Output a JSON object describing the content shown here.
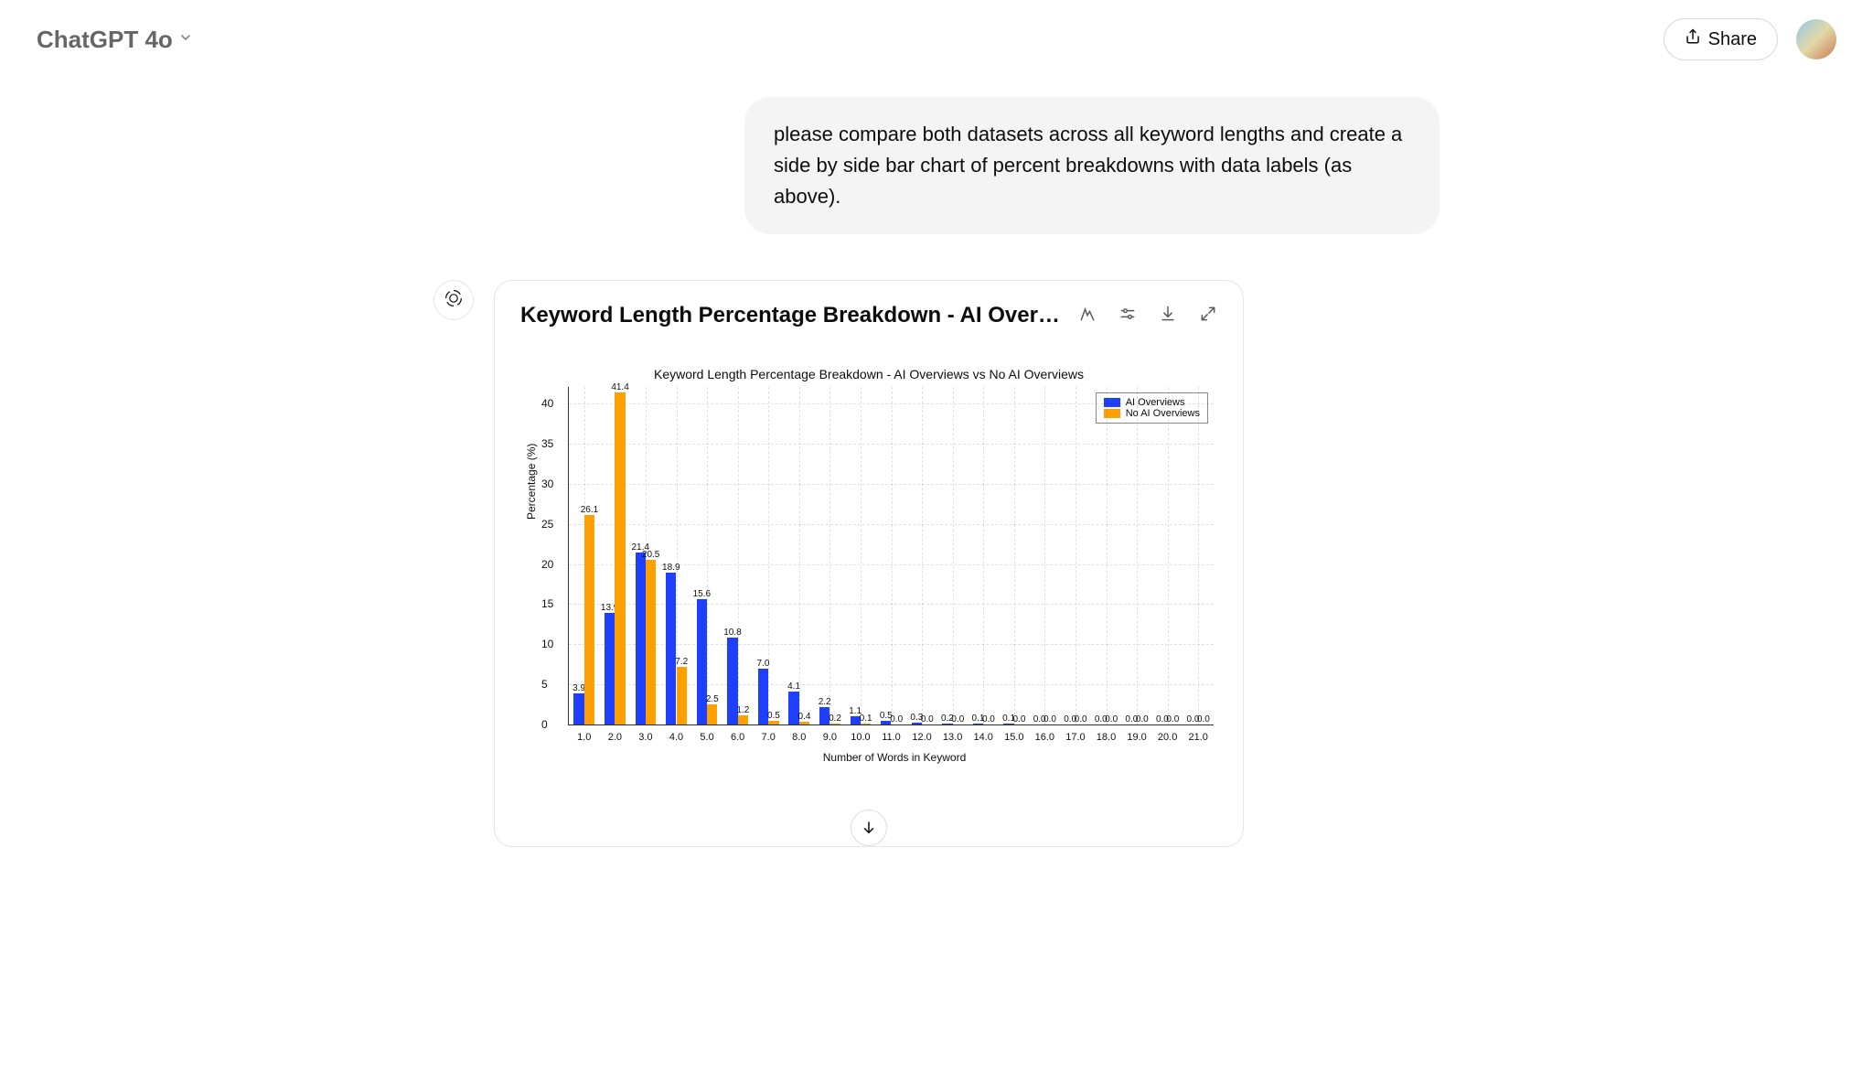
{
  "topbar": {
    "model_label": "ChatGPT 4o",
    "share_label": "Share"
  },
  "user_message": "please compare both datasets across all keyword lengths and create a side by side bar chart of percent breakdowns with data labels (as above).",
  "card": {
    "title": "Keyword Length Percentage Breakdown - AI Overview..."
  },
  "chart_data": {
    "type": "bar",
    "title": "Keyword Length Percentage Breakdown - AI Overviews vs No AI Overviews",
    "xlabel": "Number of Words in Keyword",
    "ylabel": "Percentage (%)",
    "categories": [
      "1.0",
      "2.0",
      "3.0",
      "4.0",
      "5.0",
      "6.0",
      "7.0",
      "8.0",
      "9.0",
      "10.0",
      "11.0",
      "12.0",
      "13.0",
      "14.0",
      "15.0",
      "16.0",
      "17.0",
      "18.0",
      "19.0",
      "20.0",
      "21.0"
    ],
    "series": [
      {
        "name": "AI Overviews",
        "color": "#1f3fff",
        "values": [
          3.9,
          13.9,
          21.4,
          18.9,
          15.6,
          10.8,
          7.0,
          4.1,
          2.2,
          1.1,
          0.5,
          0.3,
          0.2,
          0.1,
          0.1,
          0.0,
          0.0,
          0.0,
          0.0,
          0.0,
          0.0
        ],
        "labels": [
          "3.9",
          "13.9",
          "21.4",
          "18.9",
          "15.6",
          "10.8",
          "7.0",
          "4.1",
          "2.2",
          "1.1",
          "0.5",
          "0.3",
          "0.2",
          "0.1",
          "0.1",
          "0.0",
          "0.0",
          "0.0",
          "0.0",
          "0.0",
          "0.0"
        ]
      },
      {
        "name": "No AI Overviews",
        "color": "#ff9f00",
        "values": [
          26.1,
          41.4,
          20.5,
          7.2,
          2.5,
          1.2,
          0.5,
          0.4,
          0.2,
          0.1,
          0.0,
          0.0,
          0.0,
          0.0,
          0.0,
          0.0,
          0.0,
          0.0,
          0.0,
          0.0,
          0.0
        ],
        "labels": [
          "26.1",
          "41.4",
          "20.5",
          "7.2",
          "2.5",
          "1.2",
          "0.5",
          "0.4",
          "0.2",
          "0.1",
          "0.0",
          "0.0",
          "0.0",
          "0.0",
          "0.0",
          "0.0",
          "0.0",
          "0.0",
          "0.0",
          "0.0",
          "0.0"
        ]
      }
    ],
    "yticks": [
      0,
      5,
      10,
      15,
      20,
      25,
      30,
      35,
      40
    ],
    "ylim": [
      0,
      42
    ]
  }
}
